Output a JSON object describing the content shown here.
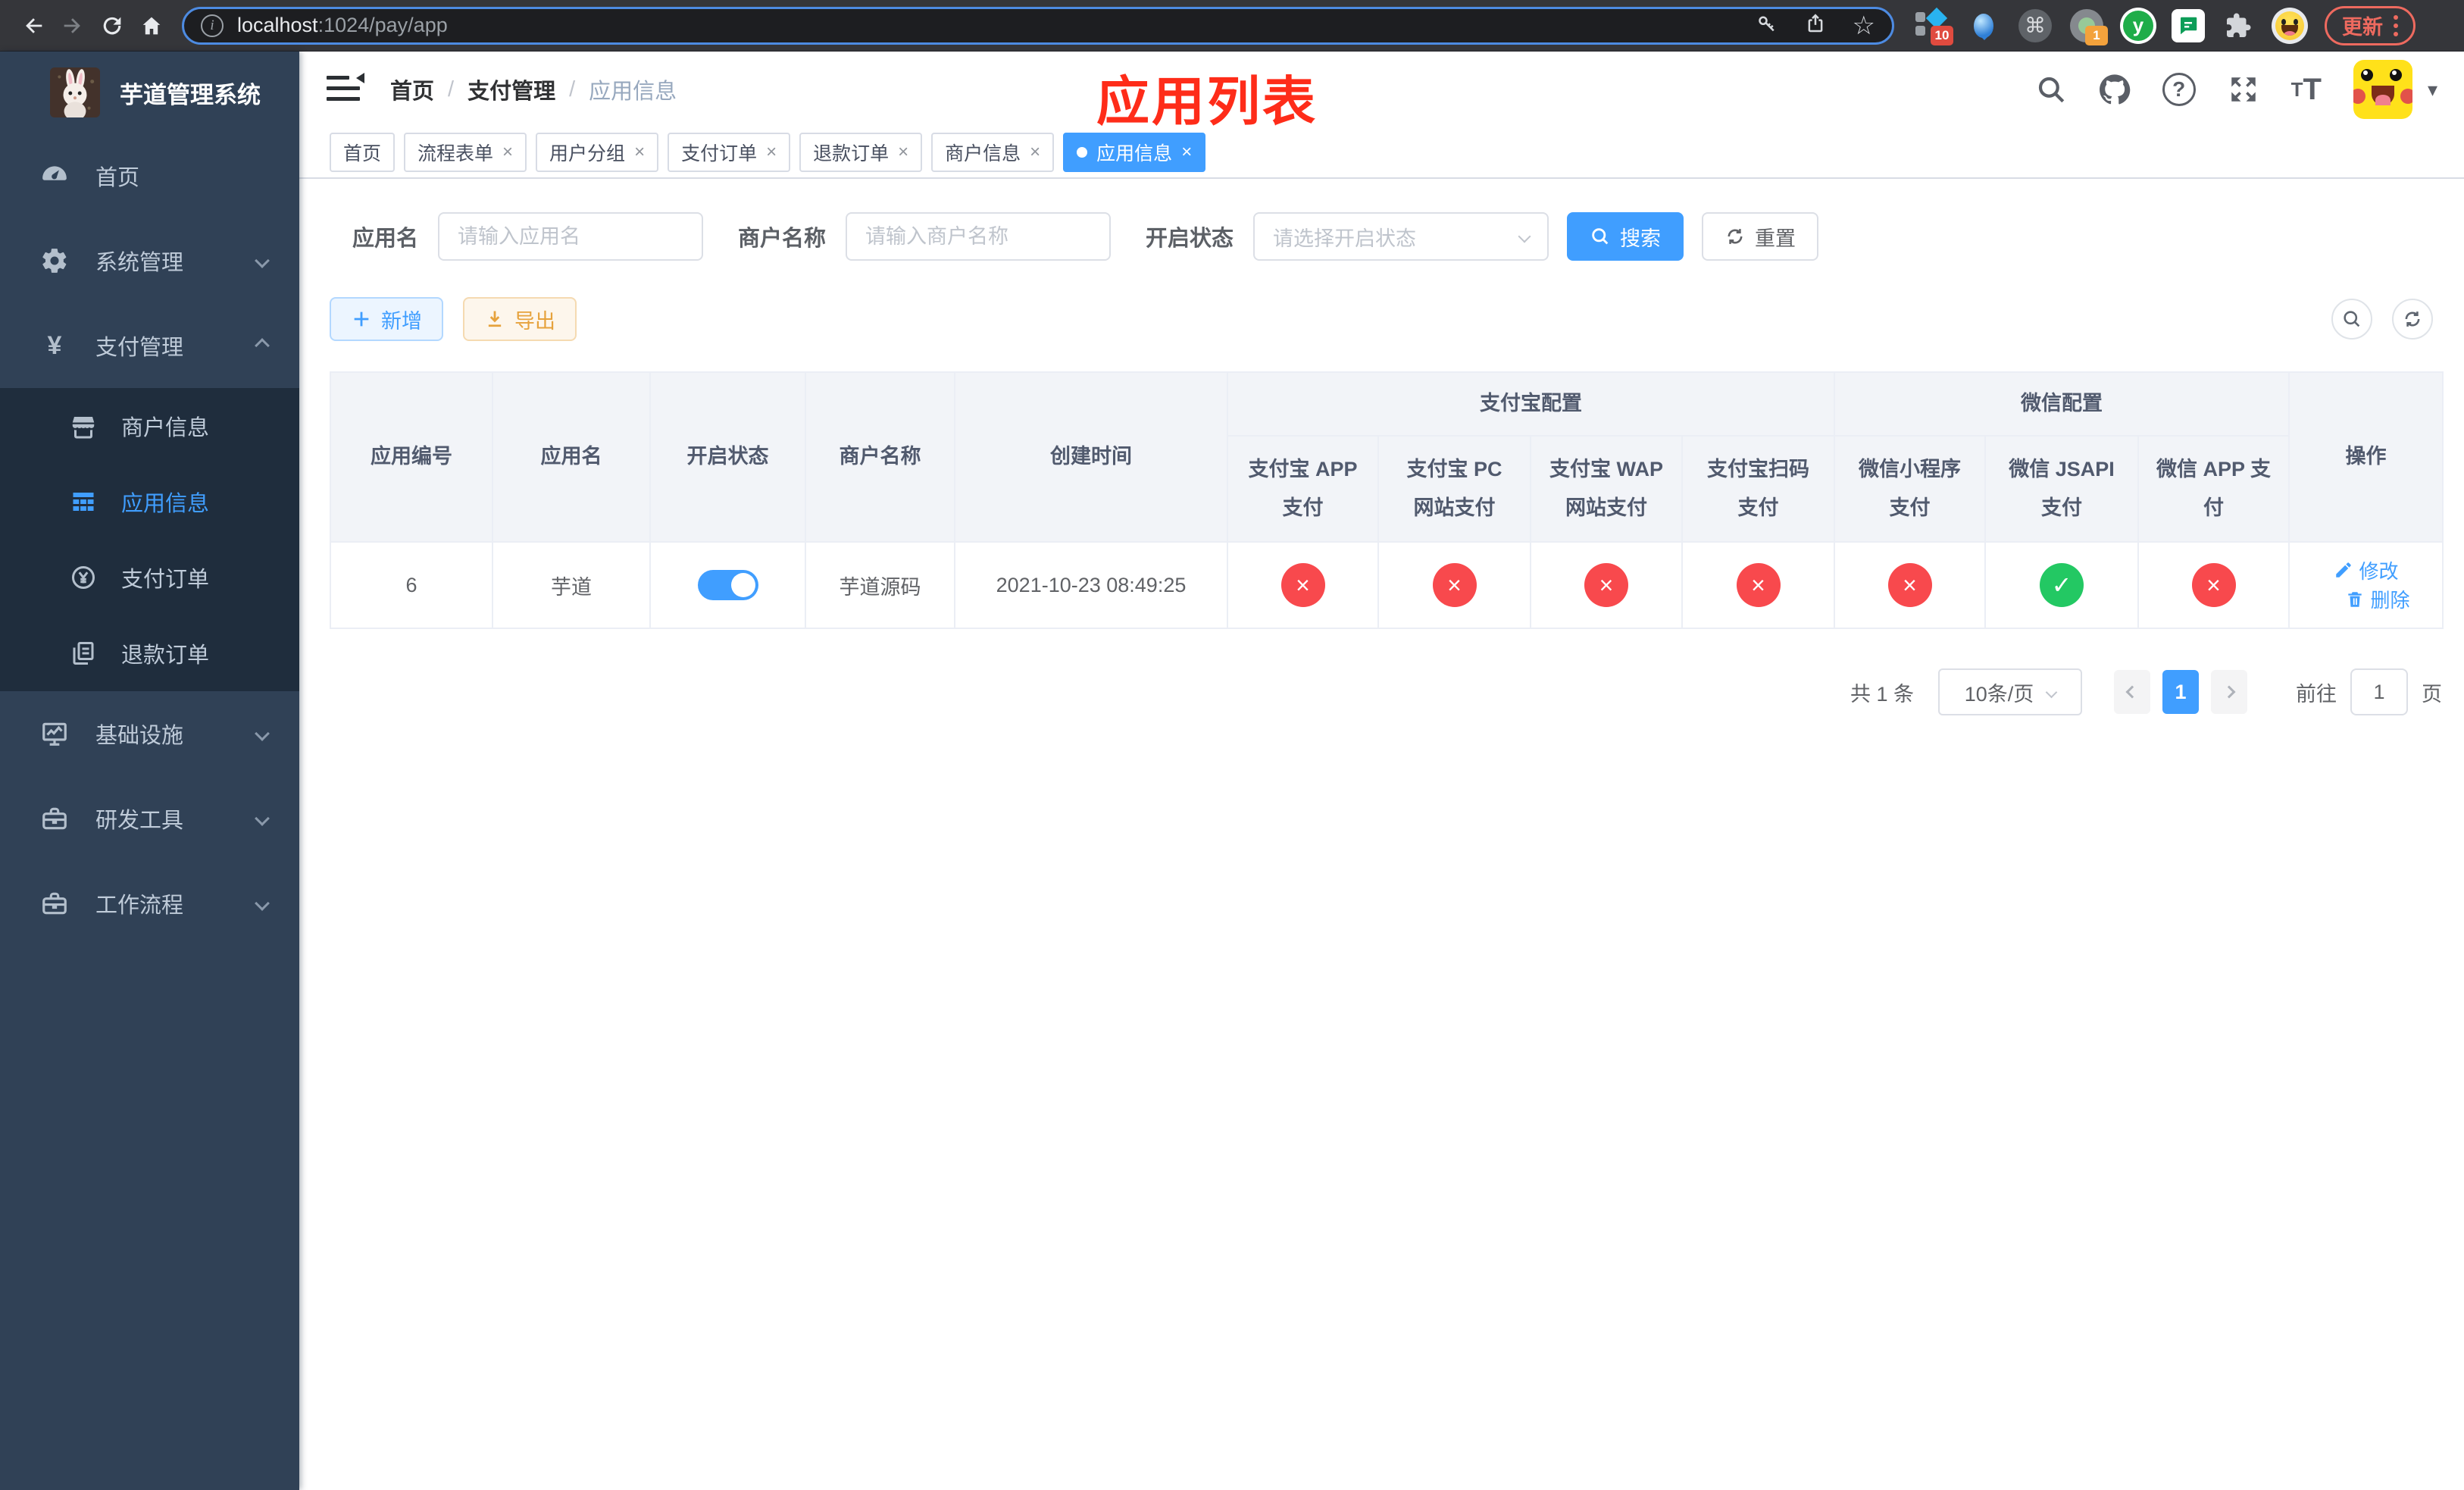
{
  "colors": {
    "accent": "#409eff",
    "success": "#23c863",
    "danger": "#f8494d",
    "warning": "#e6a23c",
    "warning_bg": "#fdf6ec",
    "warning_border": "#f5dab1",
    "primary_bg": "#ecf5ff",
    "primary_border": "#b3d8ff",
    "sidebar_bg": "#304156",
    "sidebar_sub_bg": "#1f2d3d",
    "sidebar_text": "#bfcbd9",
    "annotation": "#fe2c19",
    "chrome_bg": "#35363a",
    "urlbar_bg": "#1d1e21",
    "urlbar_focus": "#4d8be2",
    "update_red": "#ee6a5f"
  },
  "browser": {
    "url_host": "localhost",
    "url_path": ":1024/pay/app",
    "update_label": "更新",
    "ext1_badge": "10",
    "ext4_badge": "1",
    "ext_y_label": "y"
  },
  "icons": {
    "info": "i",
    "star": "☆",
    "cmd": "⌘",
    "question": "?",
    "caret": "▾",
    "yen": "¥",
    "size_small": "T",
    "size_large": "T"
  },
  "sidebar": {
    "title": "芋道管理系统",
    "items": [
      {
        "label": "首页"
      },
      {
        "label": "系统管理"
      },
      {
        "label": "支付管理"
      },
      {
        "label": "商户信息"
      },
      {
        "label": "应用信息"
      },
      {
        "label": "支付订单"
      },
      {
        "label": "退款订单"
      },
      {
        "label": "基础设施"
      },
      {
        "label": "研发工具"
      },
      {
        "label": "工作流程"
      }
    ]
  },
  "breadcrumb": {
    "sep": "/",
    "items": [
      "首页",
      "支付管理",
      "应用信息"
    ]
  },
  "annotation": "应用列表",
  "tabs": {
    "close": "×",
    "items": [
      {
        "label": "首页"
      },
      {
        "label": "流程表单"
      },
      {
        "label": "用户分组"
      },
      {
        "label": "支付订单"
      },
      {
        "label": "退款订单"
      },
      {
        "label": "商户信息"
      },
      {
        "label": "应用信息"
      }
    ]
  },
  "filters": {
    "app_name_label": "应用名",
    "app_name_placeholder": "请输入应用名",
    "merchant_label": "商户名称",
    "merchant_placeholder": "请输入商户名称",
    "status_label": "开启状态",
    "status_placeholder": "请选择开启状态",
    "search_label": "搜索",
    "reset_label": "重置"
  },
  "toolbar": {
    "add_label": "新增",
    "export_label": "导出"
  },
  "table": {
    "columns": [
      "应用编号",
      "应用名",
      "开启状态",
      "商户名称",
      "创建时间"
    ],
    "group_alipay": "支付宝配置",
    "group_wechat": "微信配置",
    "alipay_cols": [
      "支付宝 APP 支付",
      "支付宝 PC 网站支付",
      "支付宝 WAP 网站支付",
      "支付宝扫码支付"
    ],
    "wechat_cols": [
      "微信小程序支付",
      "微信 JSAPI 支付",
      "微信 APP 支付"
    ],
    "action_col": "操作",
    "row": {
      "app_id": "6",
      "app_name": "芋道",
      "enabled": true,
      "merchant": "芋道源码",
      "create_time": "2021-10-23 08:49:25",
      "channels": [
        false,
        false,
        false,
        false,
        false,
        true,
        false
      ]
    },
    "edit_label": "修改",
    "delete_label": "删除"
  },
  "pagination": {
    "total": "共 1 条",
    "page_size": "10条/页",
    "current_page": "1",
    "goto_label": "前往",
    "goto_value": "1",
    "page_suffix": "页"
  }
}
